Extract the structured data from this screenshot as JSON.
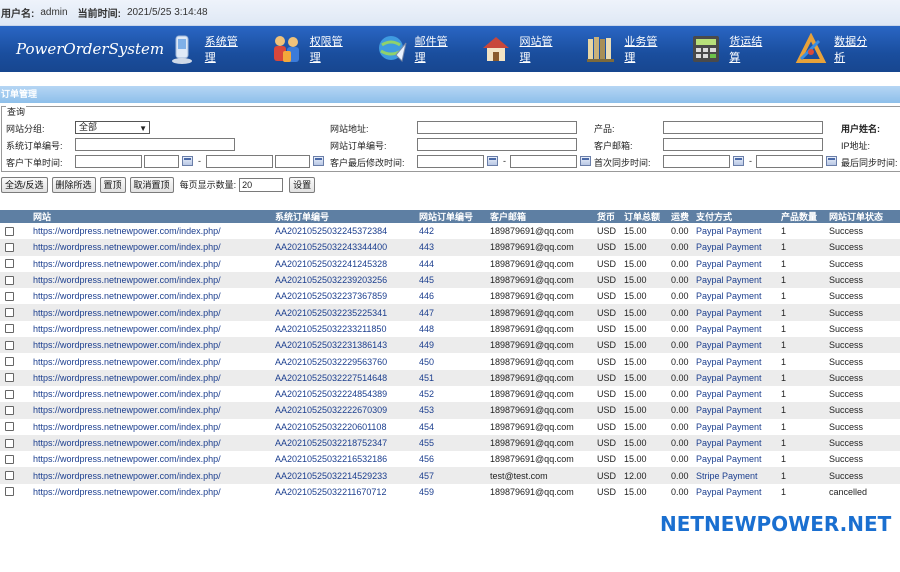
{
  "topbar": {
    "username_label": "用户名:",
    "username": "admin",
    "time_label": "当前时间:",
    "time": "2021/5/25 3:14:48"
  },
  "nav": {
    "brand": "PowerOrderSystem",
    "items": [
      {
        "label": "系统管理",
        "icon": "system-settings-icon"
      },
      {
        "label": "权限管理",
        "icon": "users-permission-icon"
      },
      {
        "label": "邮件管理",
        "icon": "mail-globe-icon"
      },
      {
        "label": "网站管理",
        "icon": "website-house-icon"
      },
      {
        "label": "业务管理",
        "icon": "business-books-icon"
      },
      {
        "label": "货运结算",
        "icon": "shipping-calculator-icon"
      },
      {
        "label": "数据分析",
        "icon": "data-analysis-tools-icon"
      }
    ]
  },
  "section_title": "订单管理",
  "query": {
    "legend": "查询",
    "site_group_label": "网站分组:",
    "site_group_value": "全部",
    "site_url_label": "网站地址:",
    "product_label": "产品:",
    "user_name_label": "用户姓名:",
    "sys_order_no_label": "系统订单编号:",
    "site_order_no_label": "网站订单编号:",
    "customer_email_label": "客户邮箱:",
    "ip_label": "IP地址:",
    "order_time_label": "客户下单时间:",
    "modify_time_label": "客户最后修改时间:",
    "first_sync_label": "首次同步时间:",
    "last_sync_label": "最后同步时间:",
    "dash": "-"
  },
  "toolbar": {
    "select_all": "全选/反选",
    "delete_selected": "删除所选",
    "pin_top": "置顶",
    "unpin_top": "取消置顶",
    "page_size_label": "每页显示数量:",
    "page_size_value": "20",
    "settings": "设置"
  },
  "table": {
    "headers": [
      "",
      "网站",
      "系统订单编号",
      "网站订单编号",
      "客户邮箱",
      "货币",
      "订单总额",
      "运费",
      "支付方式",
      "产品数量",
      "网站订单状态"
    ],
    "rows": [
      [
        "https://wordpress.netnewpower.com/index.php/",
        "AA20210525032245372384",
        "442",
        "189879691@qq.com",
        "USD",
        "15.00",
        "0.00",
        "Paypal Payment",
        "1",
        "Success"
      ],
      [
        "https://wordpress.netnewpower.com/index.php/",
        "AA20210525032243344400",
        "443",
        "189879691@qq.com",
        "USD",
        "15.00",
        "0.00",
        "Paypal Payment",
        "1",
        "Success"
      ],
      [
        "https://wordpress.netnewpower.com/index.php/",
        "AA20210525032241245328",
        "444",
        "189879691@qq.com",
        "USD",
        "15.00",
        "0.00",
        "Paypal Payment",
        "1",
        "Success"
      ],
      [
        "https://wordpress.netnewpower.com/index.php/",
        "AA20210525032239203256",
        "445",
        "189879691@qq.com",
        "USD",
        "15.00",
        "0.00",
        "Paypal Payment",
        "1",
        "Success"
      ],
      [
        "https://wordpress.netnewpower.com/index.php/",
        "AA20210525032237367859",
        "446",
        "189879691@qq.com",
        "USD",
        "15.00",
        "0.00",
        "Paypal Payment",
        "1",
        "Success"
      ],
      [
        "https://wordpress.netnewpower.com/index.php/",
        "AA20210525032235225341",
        "447",
        "189879691@qq.com",
        "USD",
        "15.00",
        "0.00",
        "Paypal Payment",
        "1",
        "Success"
      ],
      [
        "https://wordpress.netnewpower.com/index.php/",
        "AA20210525032233211850",
        "448",
        "189879691@qq.com",
        "USD",
        "15.00",
        "0.00",
        "Paypal Payment",
        "1",
        "Success"
      ],
      [
        "https://wordpress.netnewpower.com/index.php/",
        "AA20210525032231386143",
        "449",
        "189879691@qq.com",
        "USD",
        "15.00",
        "0.00",
        "Paypal Payment",
        "1",
        "Success"
      ],
      [
        "https://wordpress.netnewpower.com/index.php/",
        "AA20210525032229563760",
        "450",
        "189879691@qq.com",
        "USD",
        "15.00",
        "0.00",
        "Paypal Payment",
        "1",
        "Success"
      ],
      [
        "https://wordpress.netnewpower.com/index.php/",
        "AA20210525032227514648",
        "451",
        "189879691@qq.com",
        "USD",
        "15.00",
        "0.00",
        "Paypal Payment",
        "1",
        "Success"
      ],
      [
        "https://wordpress.netnewpower.com/index.php/",
        "AA20210525032224854389",
        "452",
        "189879691@qq.com",
        "USD",
        "15.00",
        "0.00",
        "Paypal Payment",
        "1",
        "Success"
      ],
      [
        "https://wordpress.netnewpower.com/index.php/",
        "AA20210525032222670309",
        "453",
        "189879691@qq.com",
        "USD",
        "15.00",
        "0.00",
        "Paypal Payment",
        "1",
        "Success"
      ],
      [
        "https://wordpress.netnewpower.com/index.php/",
        "AA20210525032220601108",
        "454",
        "189879691@qq.com",
        "USD",
        "15.00",
        "0.00",
        "Paypal Payment",
        "1",
        "Success"
      ],
      [
        "https://wordpress.netnewpower.com/index.php/",
        "AA20210525032218752347",
        "455",
        "189879691@qq.com",
        "USD",
        "15.00",
        "0.00",
        "Paypal Payment",
        "1",
        "Success"
      ],
      [
        "https://wordpress.netnewpower.com/index.php/",
        "AA20210525032216532186",
        "456",
        "189879691@qq.com",
        "USD",
        "15.00",
        "0.00",
        "Paypal Payment",
        "1",
        "Success"
      ],
      [
        "https://wordpress.netnewpower.com/index.php/",
        "AA20210525032214529233",
        "457",
        "test@test.com",
        "USD",
        "12.00",
        "0.00",
        "Stripe Payment",
        "1",
        "Success"
      ],
      [
        "https://wordpress.netnewpower.com/index.php/",
        "AA20210525032211670712",
        "459",
        "189879691@qq.com",
        "USD",
        "15.00",
        "0.00",
        "Paypal Payment",
        "1",
        "cancelled"
      ]
    ]
  },
  "watermark": "NETNEWPOWER.NET",
  "colors": {
    "nav_blue": "#1a4e9e",
    "header_row": "#5e7fa3",
    "link": "#1c3f8f",
    "watermark": "#1a6fd0"
  }
}
